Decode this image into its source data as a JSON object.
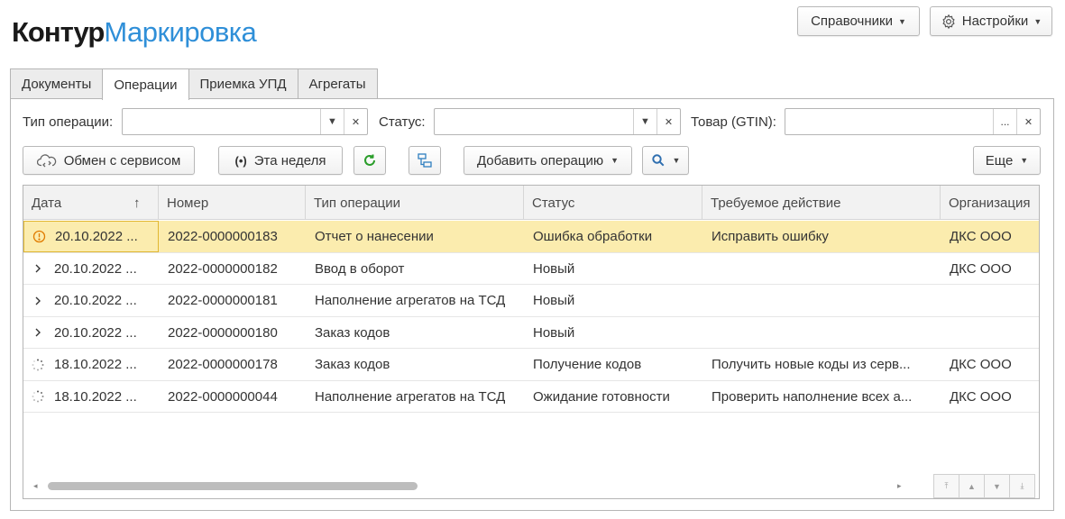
{
  "header": {
    "brand": "Контур",
    "product": "Маркировка",
    "directories_label": "Справочники",
    "settings_label": "Настройки"
  },
  "tabs": [
    {
      "label": "Документы",
      "active": false
    },
    {
      "label": "Операции",
      "active": true
    },
    {
      "label": "Приемка УПД",
      "active": false
    },
    {
      "label": "Агрегаты",
      "active": false
    }
  ],
  "filters": {
    "operation_type": {
      "label": "Тип операции:",
      "value": ""
    },
    "status": {
      "label": "Статус:",
      "value": ""
    },
    "product": {
      "label": "Товар (GTIN):",
      "value": ""
    }
  },
  "toolbar": {
    "exchange_label": "Обмен с сервисом",
    "week_label": "Эта неделя",
    "add_operation_label": "Добавить операцию",
    "more_label": "Еще"
  },
  "table": {
    "columns": [
      "Дата",
      "Номер",
      "Тип операции",
      "Статус",
      "Требуемое действие",
      "Организация"
    ],
    "sort_indicator": "↑",
    "rows": [
      {
        "state": "error",
        "date": "20.10.2022 ...",
        "number": "2022-0000000183",
        "type": "Отчет о нанесении",
        "status": "Ошибка обработки",
        "action": "Исправить ошибку",
        "org": "ДКС ООО",
        "selected": true
      },
      {
        "state": "expand",
        "date": "20.10.2022 ...",
        "number": "2022-0000000182",
        "type": "Ввод в оборот",
        "status": "Новый",
        "action": "",
        "org": "ДКС ООО",
        "selected": false
      },
      {
        "state": "expand",
        "date": "20.10.2022 ...",
        "number": "2022-0000000181",
        "type": "Наполнение агрегатов на ТСД",
        "status": "Новый",
        "action": "",
        "org": "",
        "selected": false
      },
      {
        "state": "expand",
        "date": "20.10.2022 ...",
        "number": "2022-0000000180",
        "type": "Заказ кодов",
        "status": "Новый",
        "action": "",
        "org": "",
        "selected": false
      },
      {
        "state": "loading",
        "date": "18.10.2022 ...",
        "number": "2022-0000000178",
        "type": "Заказ кодов",
        "status": "Получение кодов",
        "action": "Получить новые коды из серв...",
        "org": "ДКС ООО",
        "selected": false
      },
      {
        "state": "loading",
        "date": "18.10.2022 ...",
        "number": "2022-0000000044",
        "type": "Наполнение агрегатов на ТСД",
        "status": "Ожидание готовности",
        "action": "Проверить наполнение всех а...",
        "org": "ДКС ООО",
        "selected": false
      }
    ]
  },
  "colors": {
    "brand_blue": "#2f8fd8",
    "selected_row": "#fbecae",
    "error_icon": "#e07b00",
    "refresh_green": "#2a9d2a"
  }
}
